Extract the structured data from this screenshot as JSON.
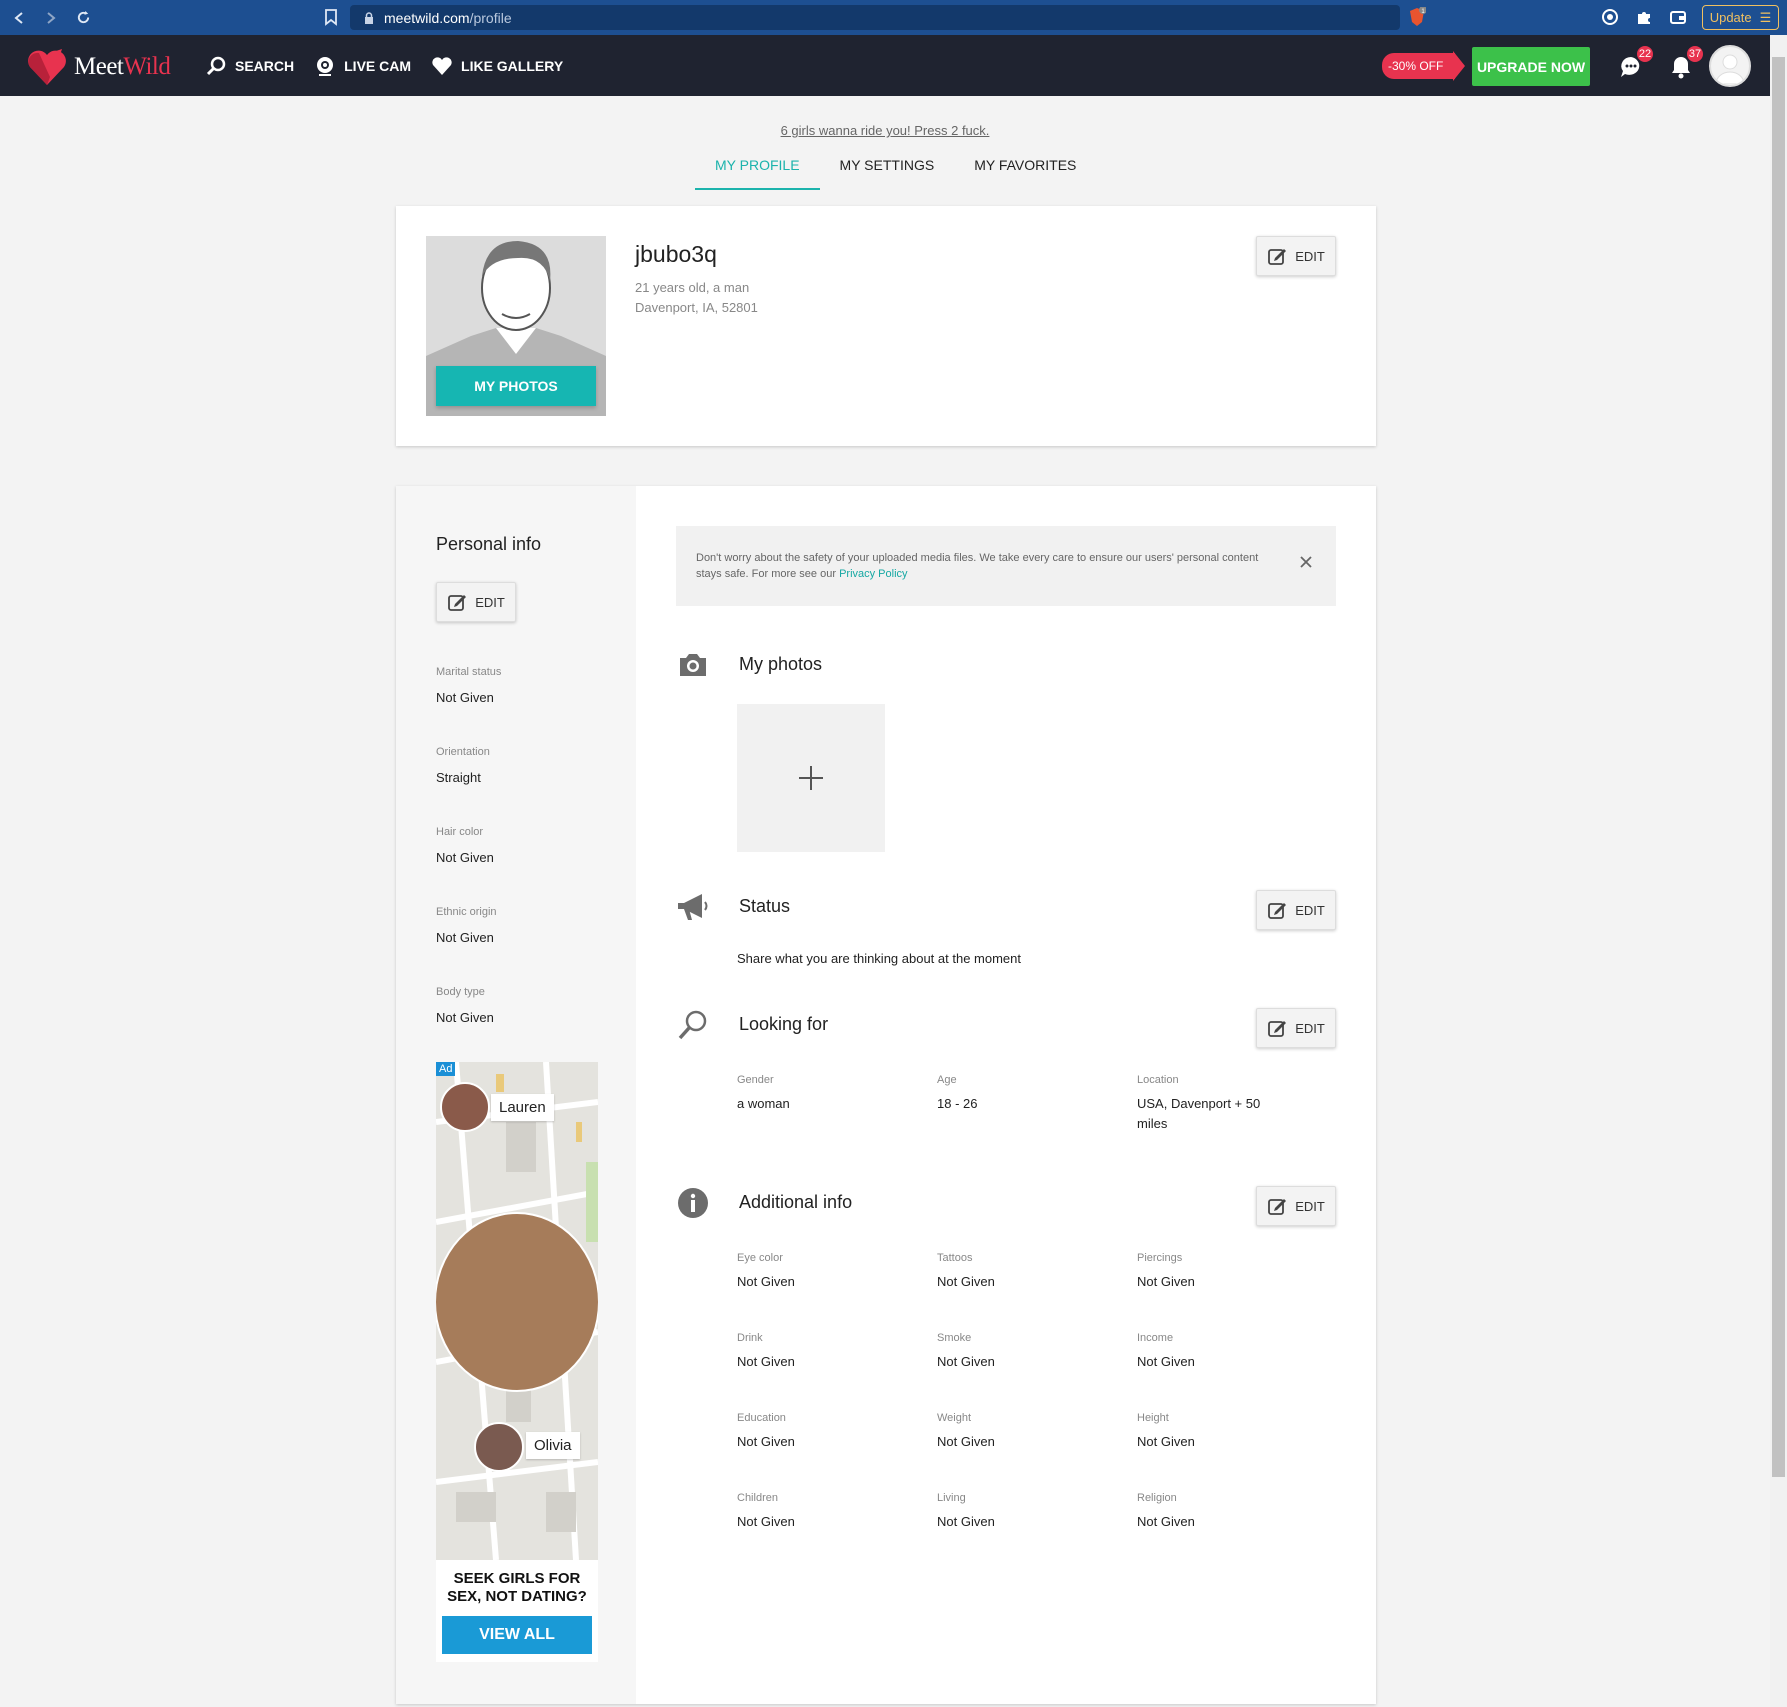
{
  "browser": {
    "url_domain": "meetwild.com",
    "url_path": "/profile",
    "update_label": "Update",
    "shield_badge": "1"
  },
  "header": {
    "logo_meet": "Meet",
    "logo_wild": "Wild",
    "menu": [
      {
        "label": "SEARCH",
        "icon": "search-icon"
      },
      {
        "label": "LIVE CAM",
        "icon": "webcam-icon"
      },
      {
        "label": "LIKE GALLERY",
        "icon": "heart-icon"
      }
    ],
    "discount": "-30% OFF",
    "upgrade_label": "UPGRADE NOW",
    "messages_count": "22",
    "notifications_count": "37"
  },
  "promo_text": "6 girls wanna ride you! Press 2 fuck.",
  "tabs": [
    "MY PROFILE",
    "MY SETTINGS",
    "MY FAVORITES"
  ],
  "profile": {
    "username": "jbubo3q",
    "age_gender": "21 years old, a man",
    "location": "Davenport, IA, 52801",
    "my_photos_label": "MY PHOTOS",
    "edit_label": "EDIT"
  },
  "personal_info": {
    "title": "Personal info",
    "edit_label": "EDIT",
    "fields": [
      {
        "label": "Marital status",
        "value": "Not Given"
      },
      {
        "label": "Orientation",
        "value": "Straight"
      },
      {
        "label": "Hair color",
        "value": "Not Given"
      },
      {
        "label": "Ethnic origin",
        "value": "Not Given"
      },
      {
        "label": "Body type",
        "value": "Not Given"
      }
    ]
  },
  "ad": {
    "label": "Ad",
    "name1": "Lauren",
    "name2": "Olivia",
    "tagline_line1": "SEEK GIRLS FOR",
    "tagline_line2": "SEX, NOT DATING?",
    "button": "VIEW ALL"
  },
  "notice": {
    "text": "Don't worry about the safety of your uploaded media files. We take every care to ensure our users' personal content stays safe. For more see our ",
    "link": "Privacy Policy"
  },
  "sections": {
    "photos_title": "My photos",
    "status_title": "Status",
    "status_text": "Share what you are thinking about at the moment",
    "looking_title": "Looking for",
    "additional_title": "Additional info",
    "edit_label": "EDIT"
  },
  "looking_for": [
    {
      "label": "Gender",
      "value": "a woman"
    },
    {
      "label": "Age",
      "value": "18 - 26"
    },
    {
      "label": "Location",
      "value": "USA, Davenport + 50 miles"
    }
  ],
  "additional": [
    {
      "label": "Eye color",
      "value": "Not Given"
    },
    {
      "label": "Tattoos",
      "value": "Not Given"
    },
    {
      "label": "Piercings",
      "value": "Not Given"
    },
    {
      "label": "Drink",
      "value": "Not Given"
    },
    {
      "label": "Smoke",
      "value": "Not Given"
    },
    {
      "label": "Income",
      "value": "Not Given"
    },
    {
      "label": "Education",
      "value": "Not Given"
    },
    {
      "label": "Weight",
      "value": "Not Given"
    },
    {
      "label": "Height",
      "value": "Not Given"
    },
    {
      "label": "Children",
      "value": "Not Given"
    },
    {
      "label": "Living",
      "value": "Not Given"
    },
    {
      "label": "Religion",
      "value": "Not Given"
    }
  ],
  "colors": {
    "accent": "#1bb3ac",
    "brand_red": "#e8334f",
    "upgrade_green": "#3cc14a",
    "header_bg": "#1f2330",
    "browser_bg": "#1d4f91"
  }
}
